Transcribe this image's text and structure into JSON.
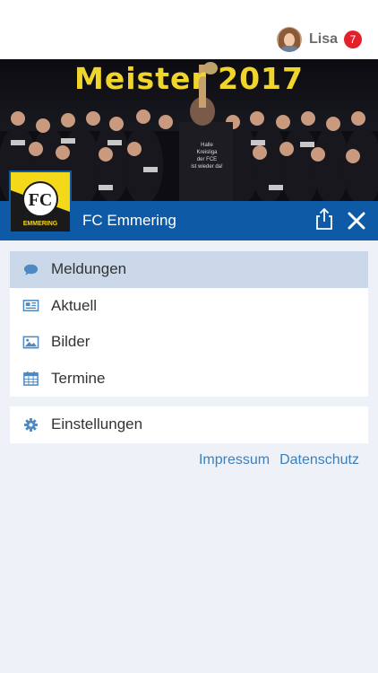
{
  "user": {
    "name": "Lisa",
    "notification_count": "7"
  },
  "hero": {
    "title": "Meister  2017",
    "banner_text": [
      "Halle",
      "Kreisliga",
      "der FCE",
      "ist wieder da!"
    ]
  },
  "club": {
    "name": "FC Emmering",
    "logo_text": "EMMERING"
  },
  "menu": {
    "items": [
      {
        "label": "Meldungen",
        "icon": "chat-bubble-icon"
      },
      {
        "label": "Aktuell",
        "icon": "newspaper-icon"
      },
      {
        "label": "Bilder",
        "icon": "image-icon"
      },
      {
        "label": "Termine",
        "icon": "calendar-icon"
      }
    ],
    "settings": {
      "label": "Einstellungen",
      "icon": "gear-icon"
    }
  },
  "footer": {
    "impressum": "Impressum",
    "datenschutz": "Datenschutz"
  },
  "colors": {
    "brand_blue": "#0f5aa6",
    "active_bg": "#cad8ea",
    "icon_blue": "#4d8ac4",
    "badge_red": "#e4202a",
    "title_yellow": "#f0d62b",
    "link": "#3d7fb8"
  }
}
